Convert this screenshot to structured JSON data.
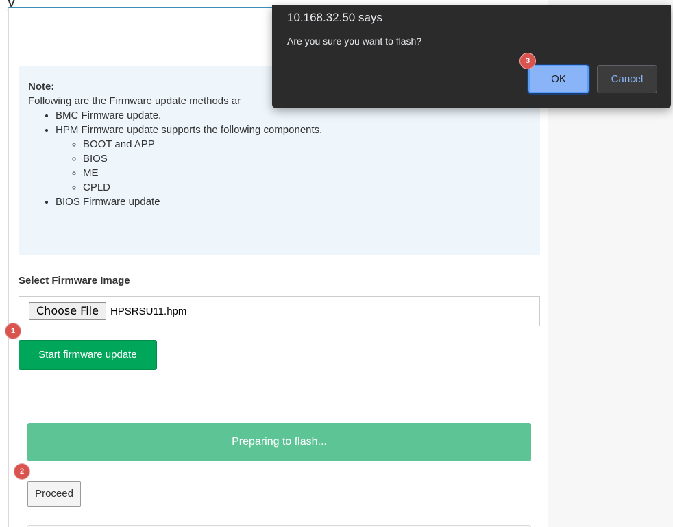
{
  "page": {
    "title_fragment": "y"
  },
  "note": {
    "title": "Note:",
    "intro": "Following are the Firmware update methods ar",
    "items": [
      {
        "label": "BMC Firmware update."
      },
      {
        "label": "HPM Firmware update supports the following components."
      },
      {
        "label": "BIOS Firmware update"
      }
    ],
    "hpm_components": [
      "BOOT and APP",
      "BIOS",
      "ME",
      "CPLD"
    ]
  },
  "firmware": {
    "select_label": "Select Firmware Image",
    "choose_file_label": "Choose File",
    "file_name": "HPSRSU11.hpm",
    "start_button": "Start firmware update",
    "progress_text": "Preparing to flash...",
    "progress_fraction": 1.0,
    "proceed_button": "Proceed"
  },
  "steps": [
    "1",
    "2",
    "3"
  ],
  "dialog": {
    "title": "10.168.32.50 says",
    "message": "Are you sure you want to flash?",
    "ok_label": "OK",
    "cancel_label": "Cancel"
  },
  "colors": {
    "start_button": "#00a65a",
    "progress_bar": "#5dc495",
    "note_background": "#eef5fb",
    "step_badge": "#d9534f",
    "dialog_background": "#2b2b2b",
    "dialog_ok": "#8ab4f8"
  }
}
